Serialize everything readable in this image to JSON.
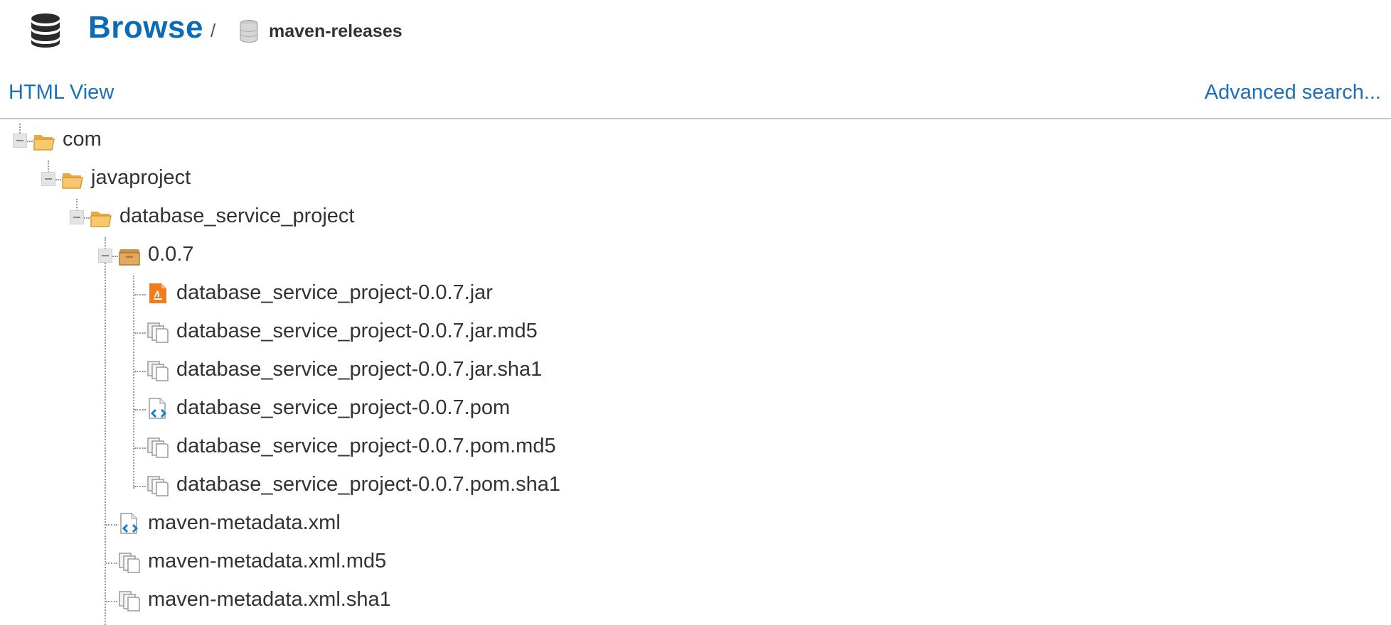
{
  "header": {
    "title": "Browse",
    "separator": "/",
    "repository": "maven-releases",
    "title_color": "#0a6bb8"
  },
  "toolbar": {
    "html_view": "HTML View",
    "advanced_search": "Advanced search..."
  },
  "tree": {
    "nodes": [
      {
        "label": "com",
        "type": "folder-open",
        "expanded": true
      },
      {
        "label": "javaproject",
        "type": "folder-open",
        "expanded": true
      },
      {
        "label": "database_service_project",
        "type": "folder-open",
        "expanded": true
      },
      {
        "label": "0.0.7",
        "type": "package",
        "expanded": true
      },
      {
        "label": "database_service_project-0.0.7.jar",
        "type": "jar"
      },
      {
        "label": "database_service_project-0.0.7.jar.md5",
        "type": "file"
      },
      {
        "label": "database_service_project-0.0.7.jar.sha1",
        "type": "file"
      },
      {
        "label": "database_service_project-0.0.7.pom",
        "type": "xml"
      },
      {
        "label": "database_service_project-0.0.7.pom.md5",
        "type": "file"
      },
      {
        "label": "database_service_project-0.0.7.pom.sha1",
        "type": "file"
      },
      {
        "label": "maven-metadata.xml",
        "type": "xml"
      },
      {
        "label": "maven-metadata.xml.md5",
        "type": "file"
      },
      {
        "label": "maven-metadata.xml.sha1",
        "type": "file"
      }
    ]
  },
  "colors": {
    "link": "#1d6fb8",
    "folder": "#f5c26b",
    "package": "#d9a05b",
    "jar": "#f07c1e"
  }
}
